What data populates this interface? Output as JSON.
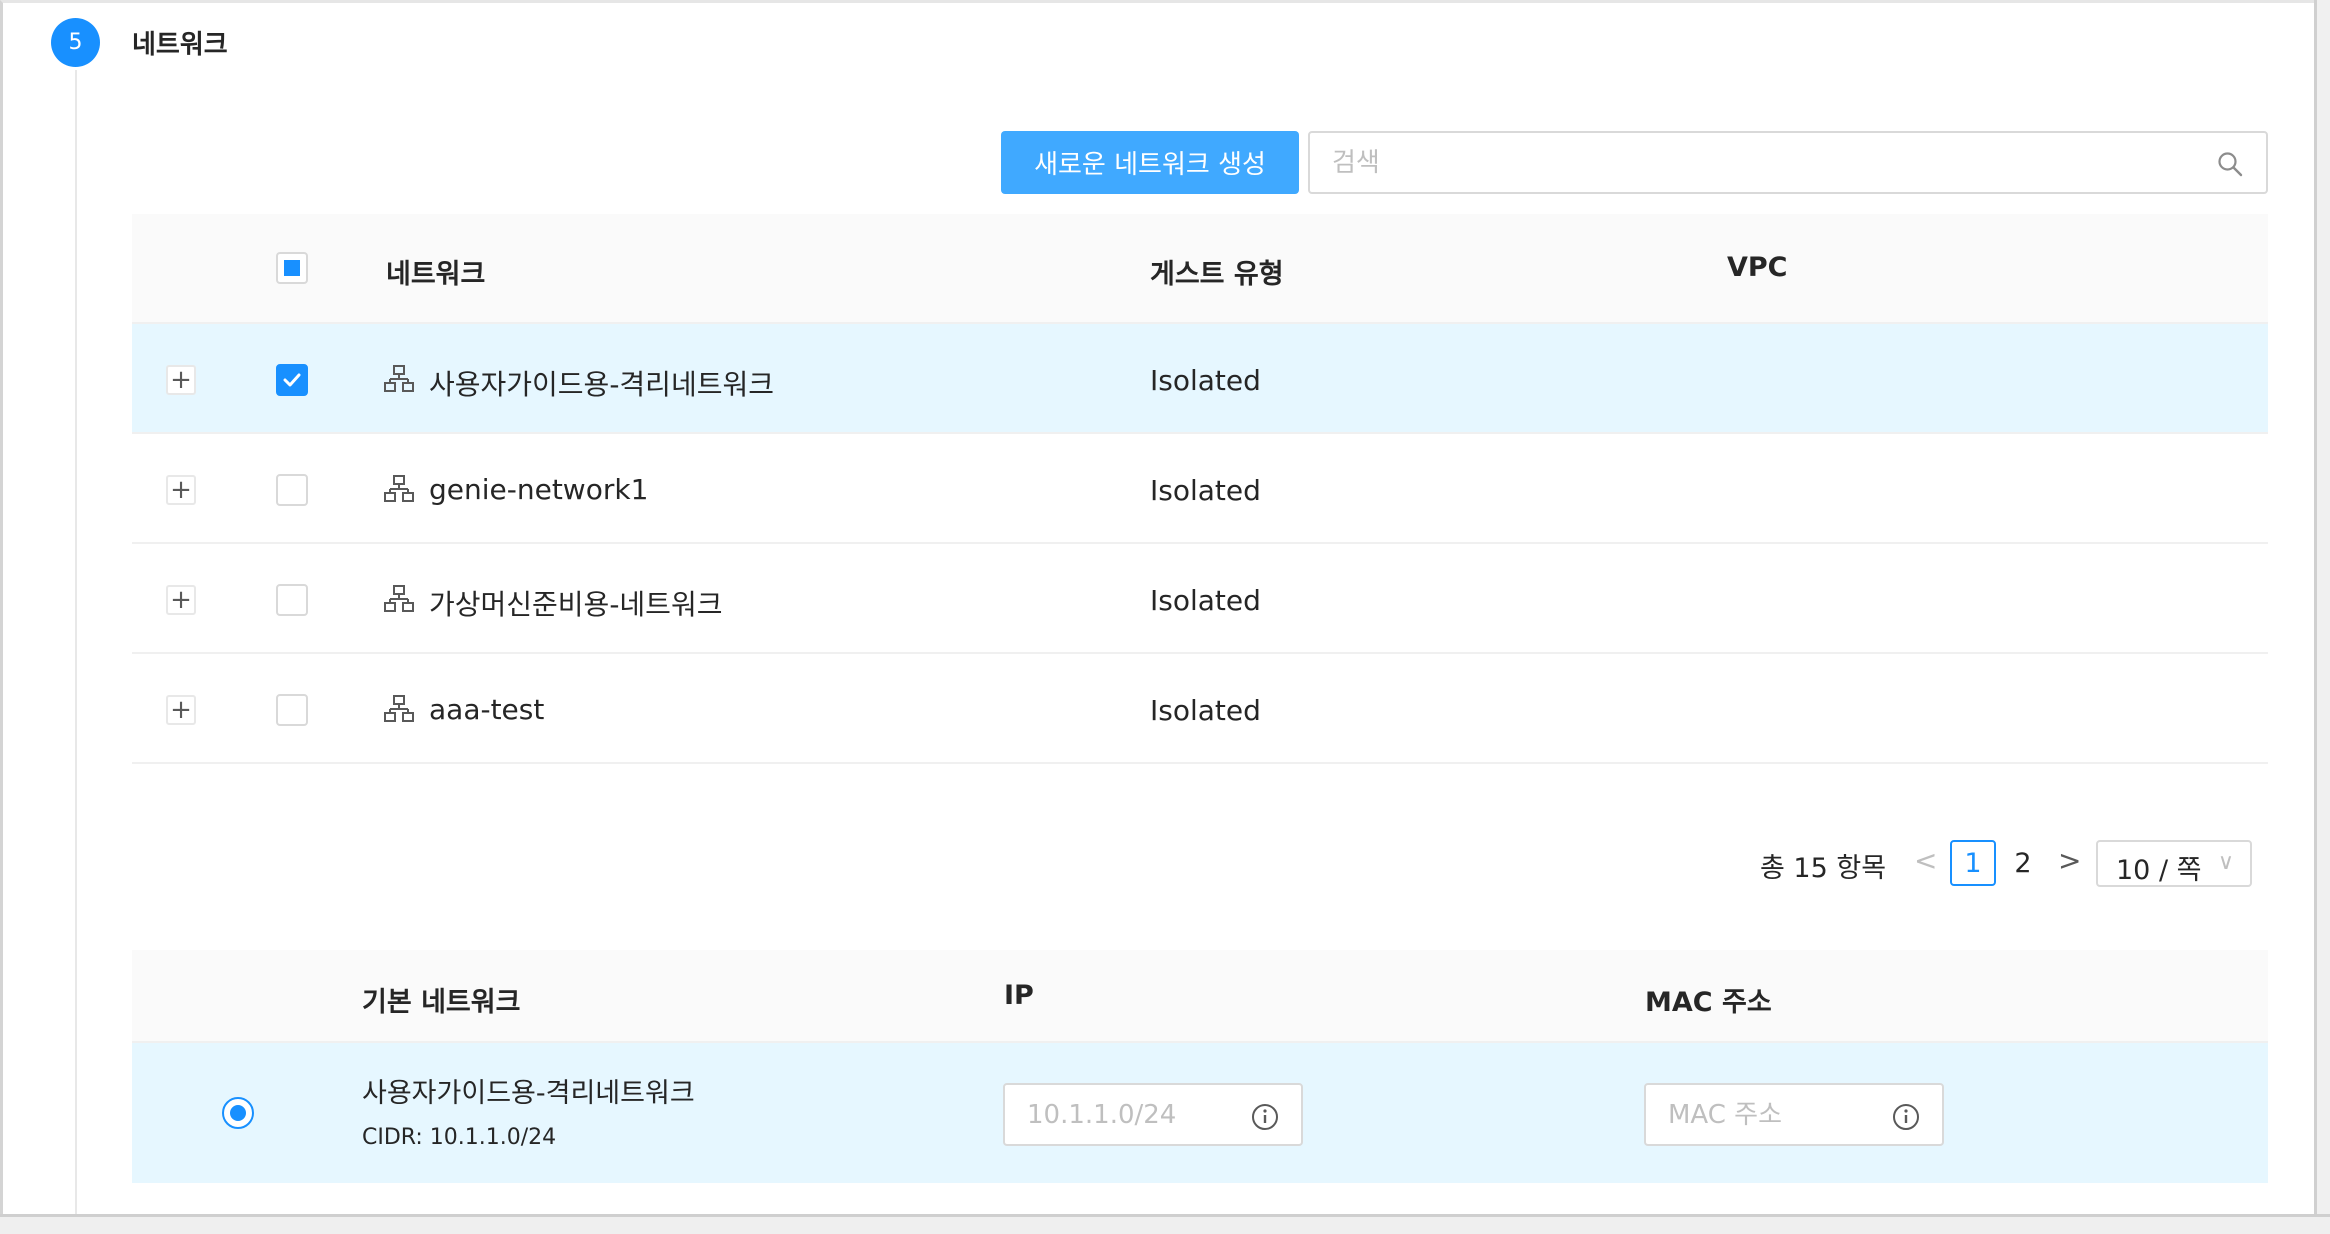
{
  "step": {
    "number": "5",
    "title": "네트워크"
  },
  "toolbar": {
    "create_button": "새로운 네트워크 생성",
    "search_placeholder": "검색"
  },
  "network_table": {
    "headers": {
      "network": "네트워크",
      "guest_type": "게스트 유형",
      "vpc": "VPC"
    },
    "rows": [
      {
        "name": "사용자가이드용-격리네트워크",
        "guest_type": "Isolated",
        "vpc": "",
        "checked": true
      },
      {
        "name": "genie-network1",
        "guest_type": "Isolated",
        "vpc": "",
        "checked": false
      },
      {
        "name": "가상머신준비용-네트워크",
        "guest_type": "Isolated",
        "vpc": "",
        "checked": false
      },
      {
        "name": "aaa-test",
        "guest_type": "Isolated",
        "vpc": "",
        "checked": false
      }
    ]
  },
  "pagination": {
    "total": "총 15 항목",
    "pages": [
      "1",
      "2"
    ],
    "current": "1",
    "page_size": "10 / 쪽"
  },
  "selected_table": {
    "headers": {
      "default_network": "기본 네트워크",
      "ip": "IP",
      "mac": "MAC 주소"
    },
    "row": {
      "name": "사용자가이드용-격리네트워크",
      "cidr": "CIDR: 10.1.1.0/24",
      "ip_placeholder": "10.1.1.0/24",
      "mac_placeholder": "MAC 주소"
    }
  },
  "colors": {
    "primary": "#1890ff",
    "button": "#40a9ff",
    "selected_row": "#e6f7ff",
    "header_bg": "#fafafa"
  }
}
